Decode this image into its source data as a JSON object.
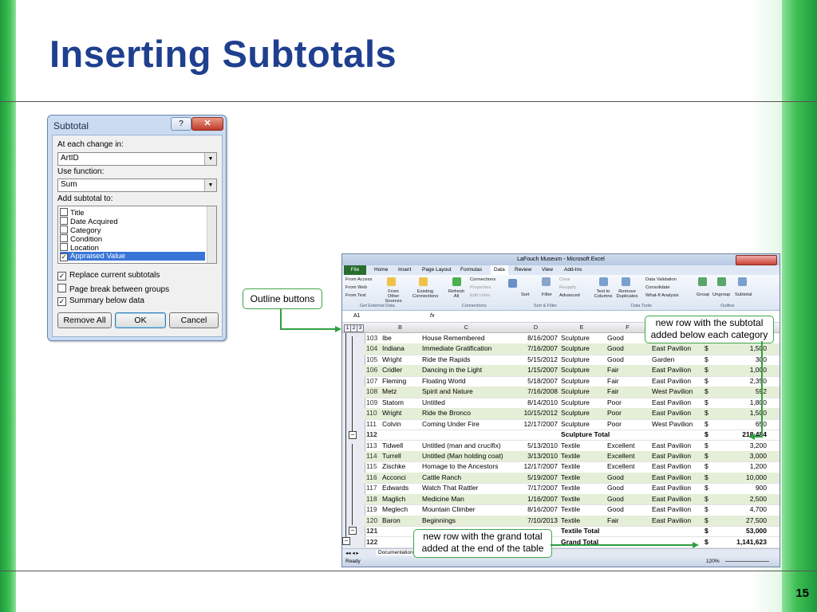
{
  "slide": {
    "title": "Inserting Subtotals",
    "page_number": "15"
  },
  "dialog": {
    "title": "Subtotal",
    "help_label": "?",
    "close_label": "✕",
    "at_each_change_label": "At each change in:",
    "at_each_change_value": "ArtID",
    "use_function_label": "Use function:",
    "use_function_value": "Sum",
    "add_subtotal_label": "Add subtotal to:",
    "fields": [
      {
        "label": "Title",
        "checked": false
      },
      {
        "label": "Date Acquired",
        "checked": false
      },
      {
        "label": "Category",
        "checked": false
      },
      {
        "label": "Condition",
        "checked": false
      },
      {
        "label": "Location",
        "checked": false
      },
      {
        "label": "Appraised Value",
        "checked": true
      }
    ],
    "options": [
      {
        "label": "Replace current subtotals",
        "checked": true
      },
      {
        "label": "Page break between groups",
        "checked": false
      },
      {
        "label": "Summary below data",
        "checked": true
      }
    ],
    "remove_all_label": "Remove All",
    "ok_label": "OK",
    "cancel_label": "Cancel"
  },
  "callouts": {
    "outline": "Outline buttons",
    "subtotal_row": [
      "new row with the subtotal",
      "added below each category"
    ],
    "grand_total_row": [
      "new row with the grand total",
      "added at the end of the table"
    ]
  },
  "excel": {
    "window_title": "LaFouch Museum - Microsoft Excel",
    "file_tab": "File",
    "tabs": [
      "Home",
      "Insert",
      "Page Layout",
      "Formulas",
      "Data",
      "Review",
      "View",
      "Add-Ins"
    ],
    "ribbon": {
      "from_access": "From Access",
      "from_web": "From Web",
      "from_text": "From Text",
      "from_other": "From Other Sources",
      "existing": "Existing Connections",
      "group_external": "Get External Data",
      "refresh": "Refresh All",
      "connections": "Connections",
      "properties": "Properties",
      "edit_links": "Edit Links",
      "group_connections": "Connections",
      "sort": "Sort",
      "filter": "Filter",
      "clear": "Clear",
      "reapply": "Reapply",
      "advanced": "Advanced",
      "group_sort": "Sort & Filter",
      "text_to_columns": "Text to Columns",
      "remove_duplicates": "Remove Duplicates",
      "data_validation": "Data Validation",
      "consolidate": "Consolidate",
      "what_if": "What-If Analysis",
      "group_tools": "Data Tools",
      "group": "Group",
      "ungroup": "Ungroup",
      "subtotal": "Subtotal",
      "group_outline": "Outline"
    },
    "name_box": "A1",
    "fx": "fx",
    "outline_levels": [
      "1",
      "2",
      "3"
    ],
    "columns": [
      "B",
      "C",
      "D",
      "E",
      "F"
    ],
    "rows": [
      {
        "n": "103",
        "b": "Ibe",
        "c": "House Remembered",
        "d": "8/16/2007",
        "e": "Sculpture",
        "f": "Good",
        "g": "",
        "cur": "",
        "h": ""
      },
      {
        "n": "104",
        "b": "Indiana",
        "c": "Immediate Gratification",
        "d": "7/16/2007",
        "e": "Sculpture",
        "f": "Good",
        "g": "East Pavilion",
        "cur": "$",
        "h": "1,500"
      },
      {
        "n": "105",
        "b": "Wright",
        "c": "Ride the Rapids",
        "d": "5/15/2012",
        "e": "Sculpture",
        "f": "Good",
        "g": "Garden",
        "cur": "$",
        "h": "300"
      },
      {
        "n": "106",
        "b": "Cridler",
        "c": "Dancing in the Light",
        "d": "1/15/2007",
        "e": "Sculpture",
        "f": "Fair",
        "g": "East Pavilion",
        "cur": "$",
        "h": "1,000"
      },
      {
        "n": "107",
        "b": "Fleming",
        "c": "Floating World",
        "d": "5/18/2007",
        "e": "Sculpture",
        "f": "Fair",
        "g": "East Pavilion",
        "cur": "$",
        "h": "2,350"
      },
      {
        "n": "108",
        "b": "Metz",
        "c": "Spirit and Nature",
        "d": "7/16/2008",
        "e": "Sculpture",
        "f": "Fair",
        "g": "West Pavilion",
        "cur": "$",
        "h": "592"
      },
      {
        "n": "109",
        "b": "Statom",
        "c": "Untitled",
        "d": "8/14/2010",
        "e": "Sculpture",
        "f": "Poor",
        "g": "East Pavilion",
        "cur": "$",
        "h": "1,800"
      },
      {
        "n": "110",
        "b": "Wright",
        "c": "Ride the Bronco",
        "d": "10/15/2012",
        "e": "Sculpture",
        "f": "Poor",
        "g": "East Pavilion",
        "cur": "$",
        "h": "1,500"
      },
      {
        "n": "111",
        "b": "Colvin",
        "c": "Coming Under Fire",
        "d": "12/17/2007",
        "e": "Sculpture",
        "f": "Poor",
        "g": "West Pavilion",
        "cur": "$",
        "h": "650"
      },
      {
        "n": "112",
        "b": "",
        "c": "",
        "d": "",
        "e": "Sculpture Total",
        "f": "",
        "g": "",
        "cur": "$",
        "h": "218,484"
      },
      {
        "n": "113",
        "b": "Tidwell",
        "c": "Untitled (man and crucifix)",
        "d": "5/13/2010",
        "e": "Textile",
        "f": "Excellent",
        "g": "East Pavilion",
        "cur": "$",
        "h": "3,200"
      },
      {
        "n": "114",
        "b": "Turrell",
        "c": "Untitled (Man holding coat)",
        "d": "3/13/2010",
        "e": "Textile",
        "f": "Excellent",
        "g": "East Pavilion",
        "cur": "$",
        "h": "3,000"
      },
      {
        "n": "115",
        "b": "Zischke",
        "c": "Homage to the Ancestors",
        "d": "12/17/2007",
        "e": "Textile",
        "f": "Excellent",
        "g": "East Pavilion",
        "cur": "$",
        "h": "1,200"
      },
      {
        "n": "116",
        "b": "Acconci",
        "c": "Cattle Ranch",
        "d": "5/19/2007",
        "e": "Textile",
        "f": "Good",
        "g": "East Pavilion",
        "cur": "$",
        "h": "10,000"
      },
      {
        "n": "117",
        "b": "Edwards",
        "c": "Watch That Rattler",
        "d": "7/17/2007",
        "e": "Textile",
        "f": "Good",
        "g": "East Pavilion",
        "cur": "$",
        "h": "900"
      },
      {
        "n": "118",
        "b": "Maglich",
        "c": "Medicine Man",
        "d": "1/16/2007",
        "e": "Textile",
        "f": "Good",
        "g": "East Pavilion",
        "cur": "$",
        "h": "2,500"
      },
      {
        "n": "119",
        "b": "Meglech",
        "c": "Mountain Climber",
        "d": "8/16/2007",
        "e": "Textile",
        "f": "Good",
        "g": "East Pavilion",
        "cur": "$",
        "h": "4,700"
      },
      {
        "n": "120",
        "b": "Baron",
        "c": "Beginnings",
        "d": "7/10/2013",
        "e": "Textile",
        "f": "Fair",
        "g": "East Pavilion",
        "cur": "$",
        "h": "27,500"
      },
      {
        "n": "121",
        "b": "",
        "c": "",
        "d": "",
        "e": "Textile Total",
        "f": "",
        "g": "",
        "cur": "$",
        "h": "53,000"
      },
      {
        "n": "122",
        "b": "",
        "c": "",
        "d": "",
        "e": "Grand Total",
        "f": "",
        "g": "",
        "cur": "$",
        "h": "1,141,623"
      }
    ],
    "sheet_tab": "Documentation",
    "status": "Ready",
    "zoom": "120%"
  }
}
